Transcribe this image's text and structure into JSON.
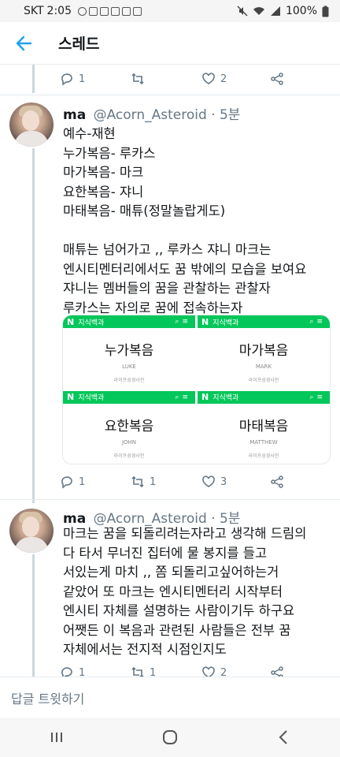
{
  "status_bar": {
    "carrier": "SKT",
    "time": "2:05",
    "battery": "100%"
  },
  "header": {
    "title": "스레드"
  },
  "top_actions": {
    "reply_count": "1",
    "retweet_count": "",
    "like_count": "2"
  },
  "tweets": [
    {
      "name": "ma",
      "handle": "@Acorn_Asteroid",
      "time": "· 5분",
      "lines_a": [
        "예수-재현",
        "누가복음- 루카스",
        "마가복음- 마크",
        "요한복음- 쟈니",
        "마태복음- 매튜(정말놀랍게도)"
      ],
      "lines_b": [
        "매튜는 넘어가고 ,, 루카스 쟈니 마크는",
        "엔시티멘터리에서도 꿈 밖에의 모습을 보여요",
        "쟈니는 멤버들의 꿈을 관찰하는 관찰자",
        "루카스는 자의로 꿈에 접속하는자"
      ],
      "media": [
        {
          "service": "지식백과",
          "logo": "N",
          "word": "누가복음",
          "roman": "LUKE",
          "source": "라이프성경사전"
        },
        {
          "service": "지식백과",
          "logo": "N",
          "word": "마가복음",
          "roman": "MARK",
          "source": "라이프성경사전"
        },
        {
          "service": "지식백과",
          "logo": "N",
          "word": "요한복음",
          "roman": "JOHN",
          "source": "라이프성경사전"
        },
        {
          "service": "지식백과",
          "logo": "N",
          "word": "마태복음",
          "roman": "MATTHEW",
          "source": "라이프성경사전"
        }
      ],
      "actions": {
        "reply_count": "1",
        "retweet_count": "1",
        "like_count": "3"
      }
    },
    {
      "name": "ma",
      "handle": "@Acorn_Asteroid",
      "time": "· 5분",
      "lines": [
        "마크는 꿈을 되돌리려는자라고 생각해 드림의",
        "다 타서 무너진 집터에 물 봉지를 들고",
        "서있는게 마치 ,, 쫌 되돌리고싶어하는거",
        "같았어 또 마크는 엔시티멘터리 시작부터",
        "엔시티 자체를 설명하는 사람이기두 하구요",
        "어쨋든 이 복음과 관련된 사람들은 전부 꿈",
        "자체에서는 전지적 시점인지도"
      ],
      "actions": {
        "reply_count": "1",
        "retweet_count": "1",
        "like_count": "2"
      }
    }
  ],
  "reply_bar": {
    "placeholder": "답글 트윗하기"
  }
}
